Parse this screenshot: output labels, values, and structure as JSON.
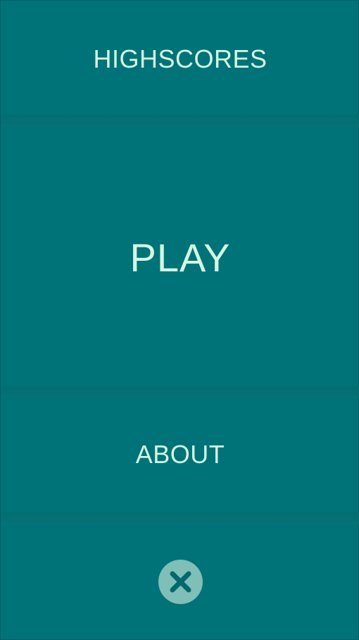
{
  "menu": {
    "highscores_label": "HIGHSCORES",
    "play_label": "PLAY",
    "about_label": "ABOUT"
  },
  "close_button": {
    "icon": "close-icon"
  },
  "colors": {
    "background": "#007378",
    "text": "#d4f7e2",
    "close_button_bg": "#7fbfb7",
    "close_icon": "#00696e"
  }
}
